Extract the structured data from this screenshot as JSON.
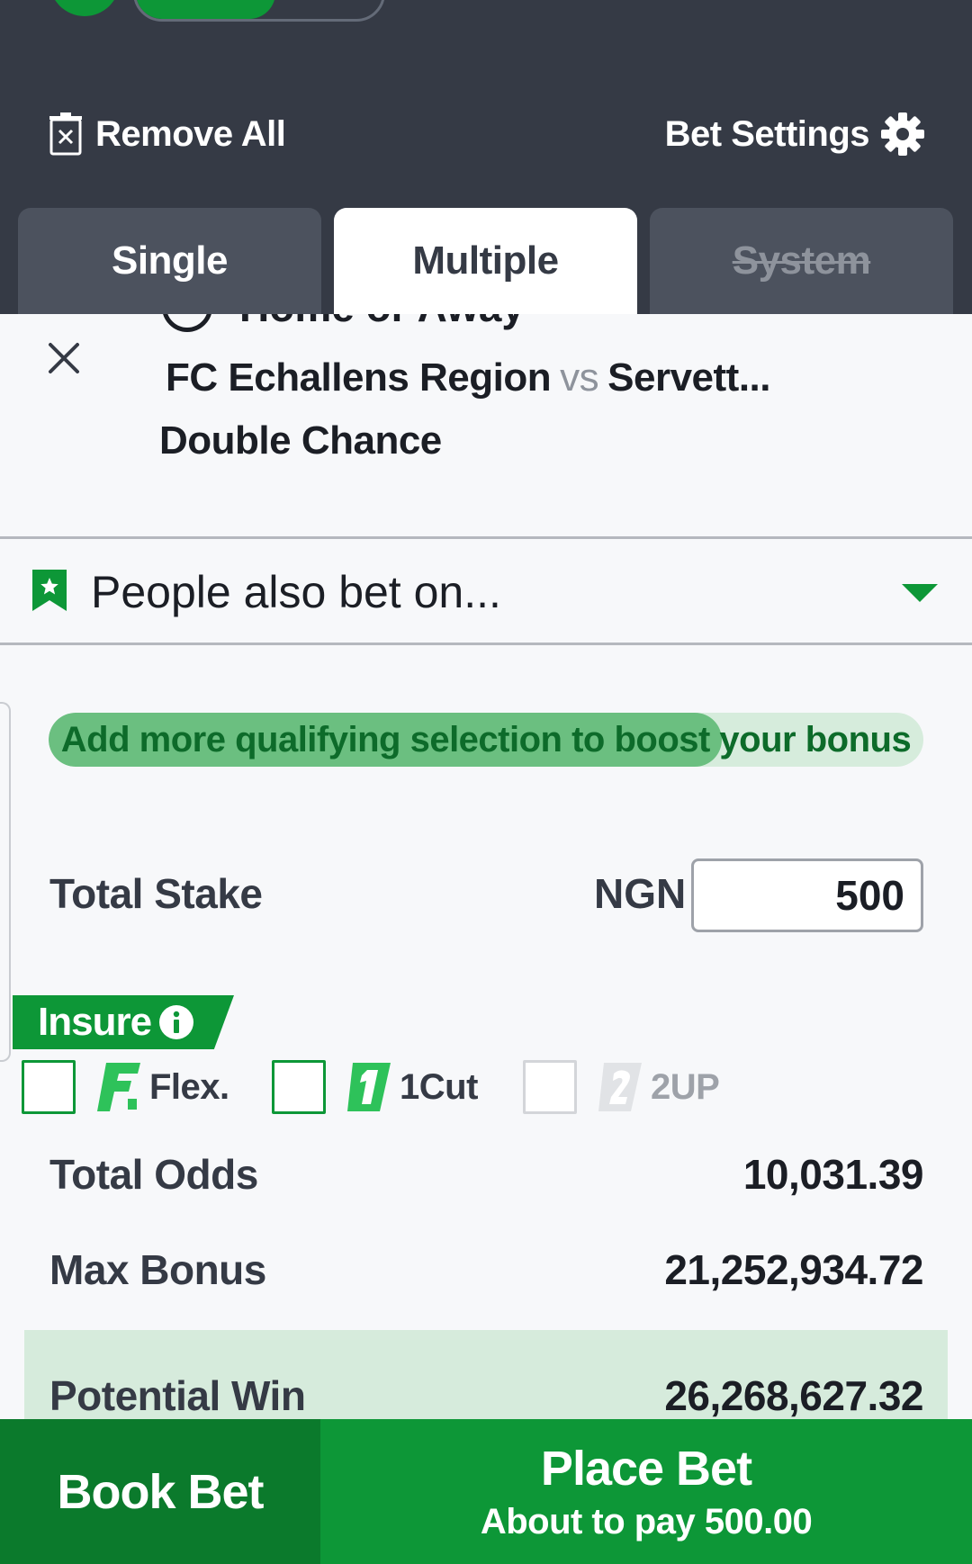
{
  "header": {
    "remove_all_label": "Remove All",
    "bet_settings_label": "Bet Settings",
    "tabs": [
      {
        "label": "Single",
        "state": "normal"
      },
      {
        "label": "Multiple",
        "state": "active"
      },
      {
        "label": "System",
        "state": "disabled"
      }
    ]
  },
  "selection": {
    "pick_partial": "Home or Away",
    "home_team": "FC Echallens Region",
    "vs": "vs",
    "away_team": "Servett...",
    "market": "Double Chance"
  },
  "also_bet": {
    "label": "People also bet on..."
  },
  "boost": {
    "label": "Add more qualifying selection to boost your bonus",
    "progress": 0.77
  },
  "stake": {
    "label": "Total Stake",
    "currency": "NGN",
    "value": "500"
  },
  "insure": {
    "label": "Insure",
    "options": [
      {
        "label": "Flex.",
        "icon": "flex-logo-icon",
        "enabled": true
      },
      {
        "label": "1Cut",
        "icon": "onecut-logo-icon",
        "enabled": true
      },
      {
        "label": "2UP",
        "icon": "twoup-logo-icon",
        "enabled": false
      }
    ]
  },
  "summary": {
    "total_odds_label": "Total Odds",
    "total_odds_value": "10,031.39",
    "max_bonus_label": "Max Bonus",
    "max_bonus_value": "21,252,934.72",
    "potential_win_label": "Potential Win",
    "potential_win_value": "26,268,627.32"
  },
  "actions": {
    "book_bet_label": "Book Bet",
    "place_bet_label": "Place Bet",
    "place_bet_sub": "About to pay 500.00"
  },
  "colors": {
    "header_bg": "#353a45",
    "brand_green": "#0d9737",
    "dark_green": "#0b7a2c",
    "light_green": "#d6ebdc"
  }
}
